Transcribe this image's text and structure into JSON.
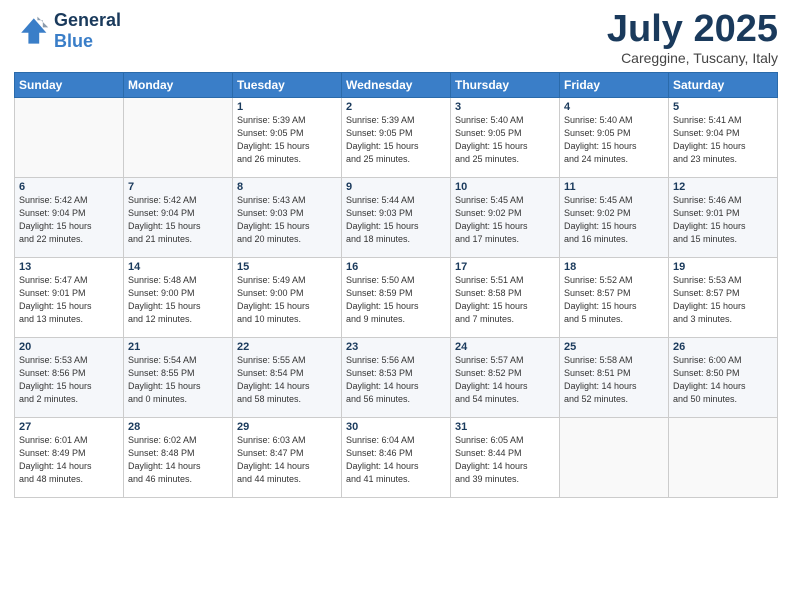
{
  "logo": {
    "line1": "General",
    "line2": "Blue"
  },
  "header": {
    "month": "July 2025",
    "location": "Careggine, Tuscany, Italy"
  },
  "weekdays": [
    "Sunday",
    "Monday",
    "Tuesday",
    "Wednesday",
    "Thursday",
    "Friday",
    "Saturday"
  ],
  "weeks": [
    [
      {
        "day": "",
        "info": ""
      },
      {
        "day": "",
        "info": ""
      },
      {
        "day": "1",
        "info": "Sunrise: 5:39 AM\nSunset: 9:05 PM\nDaylight: 15 hours\nand 26 minutes."
      },
      {
        "day": "2",
        "info": "Sunrise: 5:39 AM\nSunset: 9:05 PM\nDaylight: 15 hours\nand 25 minutes."
      },
      {
        "day": "3",
        "info": "Sunrise: 5:40 AM\nSunset: 9:05 PM\nDaylight: 15 hours\nand 25 minutes."
      },
      {
        "day": "4",
        "info": "Sunrise: 5:40 AM\nSunset: 9:05 PM\nDaylight: 15 hours\nand 24 minutes."
      },
      {
        "day": "5",
        "info": "Sunrise: 5:41 AM\nSunset: 9:04 PM\nDaylight: 15 hours\nand 23 minutes."
      }
    ],
    [
      {
        "day": "6",
        "info": "Sunrise: 5:42 AM\nSunset: 9:04 PM\nDaylight: 15 hours\nand 22 minutes."
      },
      {
        "day": "7",
        "info": "Sunrise: 5:42 AM\nSunset: 9:04 PM\nDaylight: 15 hours\nand 21 minutes."
      },
      {
        "day": "8",
        "info": "Sunrise: 5:43 AM\nSunset: 9:03 PM\nDaylight: 15 hours\nand 20 minutes."
      },
      {
        "day": "9",
        "info": "Sunrise: 5:44 AM\nSunset: 9:03 PM\nDaylight: 15 hours\nand 18 minutes."
      },
      {
        "day": "10",
        "info": "Sunrise: 5:45 AM\nSunset: 9:02 PM\nDaylight: 15 hours\nand 17 minutes."
      },
      {
        "day": "11",
        "info": "Sunrise: 5:45 AM\nSunset: 9:02 PM\nDaylight: 15 hours\nand 16 minutes."
      },
      {
        "day": "12",
        "info": "Sunrise: 5:46 AM\nSunset: 9:01 PM\nDaylight: 15 hours\nand 15 minutes."
      }
    ],
    [
      {
        "day": "13",
        "info": "Sunrise: 5:47 AM\nSunset: 9:01 PM\nDaylight: 15 hours\nand 13 minutes."
      },
      {
        "day": "14",
        "info": "Sunrise: 5:48 AM\nSunset: 9:00 PM\nDaylight: 15 hours\nand 12 minutes."
      },
      {
        "day": "15",
        "info": "Sunrise: 5:49 AM\nSunset: 9:00 PM\nDaylight: 15 hours\nand 10 minutes."
      },
      {
        "day": "16",
        "info": "Sunrise: 5:50 AM\nSunset: 8:59 PM\nDaylight: 15 hours\nand 9 minutes."
      },
      {
        "day": "17",
        "info": "Sunrise: 5:51 AM\nSunset: 8:58 PM\nDaylight: 15 hours\nand 7 minutes."
      },
      {
        "day": "18",
        "info": "Sunrise: 5:52 AM\nSunset: 8:57 PM\nDaylight: 15 hours\nand 5 minutes."
      },
      {
        "day": "19",
        "info": "Sunrise: 5:53 AM\nSunset: 8:57 PM\nDaylight: 15 hours\nand 3 minutes."
      }
    ],
    [
      {
        "day": "20",
        "info": "Sunrise: 5:53 AM\nSunset: 8:56 PM\nDaylight: 15 hours\nand 2 minutes."
      },
      {
        "day": "21",
        "info": "Sunrise: 5:54 AM\nSunset: 8:55 PM\nDaylight: 15 hours\nand 0 minutes."
      },
      {
        "day": "22",
        "info": "Sunrise: 5:55 AM\nSunset: 8:54 PM\nDaylight: 14 hours\nand 58 minutes."
      },
      {
        "day": "23",
        "info": "Sunrise: 5:56 AM\nSunset: 8:53 PM\nDaylight: 14 hours\nand 56 minutes."
      },
      {
        "day": "24",
        "info": "Sunrise: 5:57 AM\nSunset: 8:52 PM\nDaylight: 14 hours\nand 54 minutes."
      },
      {
        "day": "25",
        "info": "Sunrise: 5:58 AM\nSunset: 8:51 PM\nDaylight: 14 hours\nand 52 minutes."
      },
      {
        "day": "26",
        "info": "Sunrise: 6:00 AM\nSunset: 8:50 PM\nDaylight: 14 hours\nand 50 minutes."
      }
    ],
    [
      {
        "day": "27",
        "info": "Sunrise: 6:01 AM\nSunset: 8:49 PM\nDaylight: 14 hours\nand 48 minutes."
      },
      {
        "day": "28",
        "info": "Sunrise: 6:02 AM\nSunset: 8:48 PM\nDaylight: 14 hours\nand 46 minutes."
      },
      {
        "day": "29",
        "info": "Sunrise: 6:03 AM\nSunset: 8:47 PM\nDaylight: 14 hours\nand 44 minutes."
      },
      {
        "day": "30",
        "info": "Sunrise: 6:04 AM\nSunset: 8:46 PM\nDaylight: 14 hours\nand 41 minutes."
      },
      {
        "day": "31",
        "info": "Sunrise: 6:05 AM\nSunset: 8:44 PM\nDaylight: 14 hours\nand 39 minutes."
      },
      {
        "day": "",
        "info": ""
      },
      {
        "day": "",
        "info": ""
      }
    ]
  ]
}
